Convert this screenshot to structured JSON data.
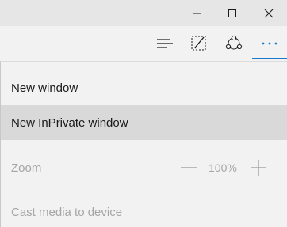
{
  "window_controls": {
    "minimize_icon": "minimize-icon",
    "maximize_icon": "maximize-icon",
    "close_icon": "close-icon"
  },
  "toolbar": {
    "hub_icon": "hub-icon",
    "web_note_icon": "web-note-icon",
    "share_icon": "share-icon",
    "more_icon": "more-icon",
    "accent_color": "#1979ca"
  },
  "menu": {
    "new_window": "New window",
    "new_inprivate_window": "New InPrivate window",
    "zoom_label": "Zoom",
    "zoom_value": "100%",
    "cast_media": "Cast media to device"
  }
}
